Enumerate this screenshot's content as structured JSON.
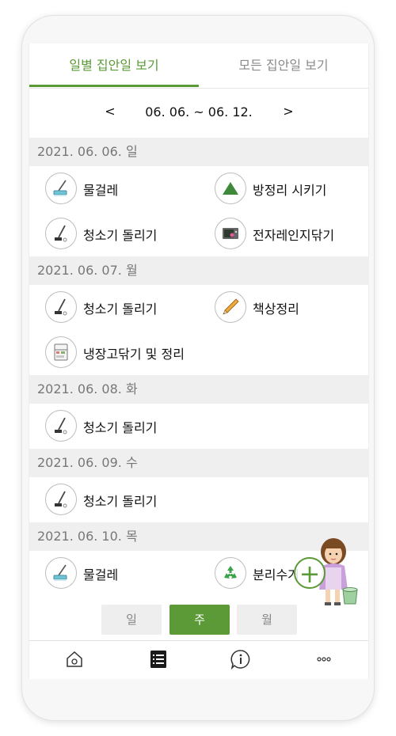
{
  "tabs": [
    {
      "label": "일별 집안일 보기",
      "active": true
    },
    {
      "label": "모든 집안일 보기",
      "active": false
    }
  ],
  "week_nav": {
    "prev": "<",
    "range": "06. 06. ~ 06. 12.",
    "next": ">"
  },
  "days": [
    {
      "header": "2021. 06. 06. 일",
      "items": [
        {
          "label": "물걸레",
          "icon": "mop-icon"
        },
        {
          "label": "방정리 시키기",
          "icon": "triangle-icon"
        },
        {
          "label": "청소기 돌리기",
          "icon": "vacuum-icon"
        },
        {
          "label": "전자레인지닦기",
          "icon": "microwave-icon"
        }
      ]
    },
    {
      "header": "2021. 06. 07. 월",
      "items": [
        {
          "label": "청소기 돌리기",
          "icon": "vacuum-icon"
        },
        {
          "label": "책상정리",
          "icon": "pencil-icon"
        },
        {
          "label": "냉장고닦기 및 정리",
          "icon": "fridge-icon"
        }
      ]
    },
    {
      "header": "2021. 06. 08. 화",
      "items": [
        {
          "label": "청소기 돌리기",
          "icon": "vacuum-icon"
        }
      ]
    },
    {
      "header": "2021. 06. 09. 수",
      "items": [
        {
          "label": "청소기 돌리기",
          "icon": "vacuum-icon"
        }
      ]
    },
    {
      "header": "2021. 06. 10. 목",
      "items": [
        {
          "label": "물걸레",
          "icon": "mop-icon"
        },
        {
          "label": "분리수거",
          "icon": "recycle-icon"
        }
      ]
    }
  ],
  "period_toggle": [
    {
      "label": "일",
      "active": false
    },
    {
      "label": "주",
      "active": true
    },
    {
      "label": "월",
      "active": false
    }
  ],
  "fab": {
    "label": "+"
  },
  "bottom_nav": [
    {
      "icon": "home-icon"
    },
    {
      "icon": "list-icon"
    },
    {
      "icon": "info-icon"
    },
    {
      "icon": "more-icon"
    }
  ],
  "colors": {
    "accent": "#5b9a37",
    "header_bg": "#efefef",
    "muted_text": "#777777"
  }
}
